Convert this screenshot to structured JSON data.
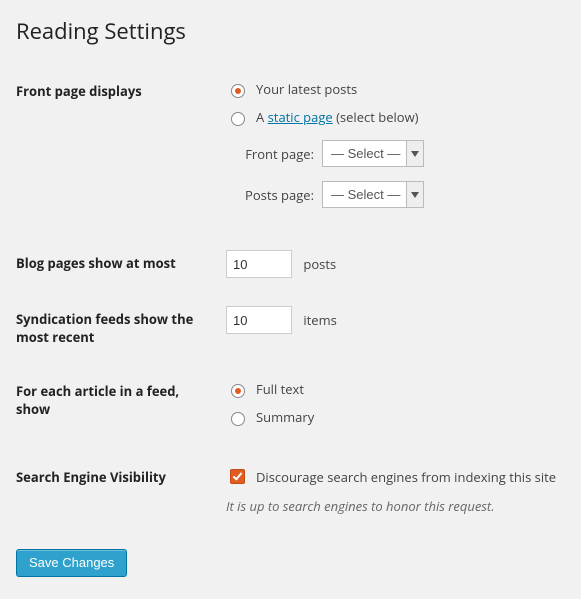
{
  "page": {
    "title": "Reading Settings"
  },
  "front_page": {
    "heading": "Front page displays",
    "opt_latest_label": "Your latest posts",
    "opt_static_prefix": "A ",
    "opt_static_linktext": "static page",
    "opt_static_suffix": " (select below)",
    "selected": "latest",
    "front_label": "Front page:",
    "posts_label": "Posts page:",
    "select_placeholder": "— Select —"
  },
  "blog_pages": {
    "heading": "Blog pages show at most",
    "value": "10",
    "suffix": "posts"
  },
  "feeds": {
    "heading": "Syndication feeds show the most recent",
    "value": "10",
    "suffix": "items"
  },
  "article_feed": {
    "heading": "For each article in a feed, show",
    "opt_full": "Full text",
    "opt_summary": "Summary",
    "selected": "full"
  },
  "visibility": {
    "heading": "Search Engine Visibility",
    "checkbox_label": "Discourage search engines from indexing this site",
    "checked": true,
    "note": "It is up to search engines to honor this request."
  },
  "submit": {
    "label": "Save Changes"
  }
}
